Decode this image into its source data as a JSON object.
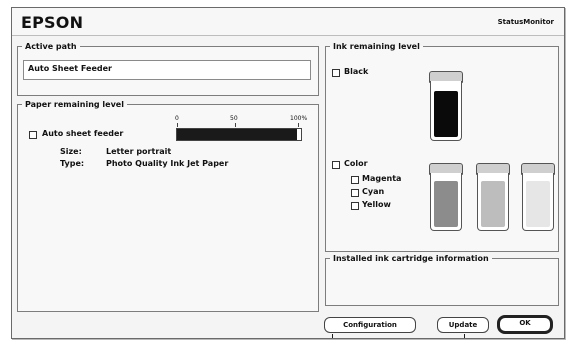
{
  "window": {
    "brand": "EPSON",
    "app_title": "StatusMonitor"
  },
  "active_path": {
    "legend": "Active path",
    "value": "Auto Sheet Feeder"
  },
  "paper": {
    "legend": "Paper remaining level",
    "scale_labels": [
      "0",
      "50",
      "100%"
    ],
    "source_label": "Auto sheet feeder",
    "level_percent": 97,
    "size_label": "Size:",
    "size_value": "Letter portrait",
    "type_label": "Type:",
    "type_value": "Photo Quality Ink Jet Paper"
  },
  "ink": {
    "legend": "Ink remaining level",
    "black_label": "Black",
    "color_label": "Color",
    "colors": [
      {
        "name": "Magenta",
        "level_percent": 88,
        "color": "#8c8c8c"
      },
      {
        "name": "Cyan",
        "level_percent": 88,
        "color": "#bdbdbd"
      },
      {
        "name": "Yellow",
        "level_percent": 88,
        "color": "#e6e6e6"
      }
    ],
    "black": {
      "level_percent": 85,
      "color": "#0a0a0a"
    }
  },
  "installed_info": {
    "legend": "Installed ink cartridge information",
    "value": ""
  },
  "buttons": {
    "configuration": "Configuration",
    "update": "Update",
    "ok": "OK"
  }
}
